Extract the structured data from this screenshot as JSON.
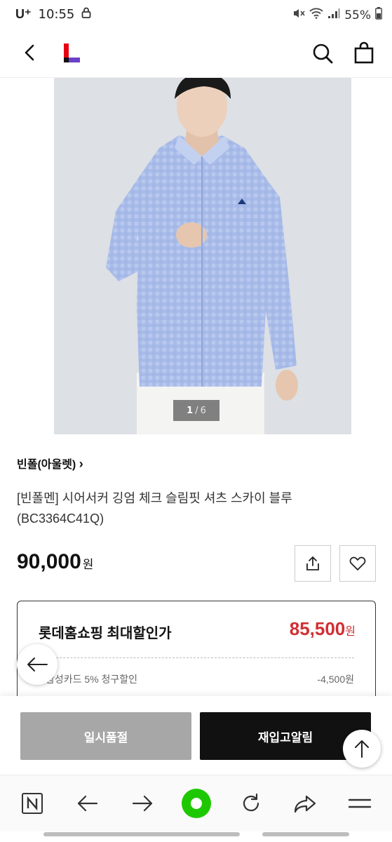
{
  "status_bar": {
    "carrier": "U⁺",
    "time": "10:55",
    "battery": "55%"
  },
  "header": {
    "logo_colors": [
      "#e60012",
      "#6a3fc9",
      "#111111"
    ]
  },
  "gallery": {
    "current": "1",
    "separator": "/",
    "total": "6"
  },
  "product": {
    "brand": "빈폴(아울렛)",
    "brand_chevron": "›",
    "title": "[빈폴멘] 시어서커 깅엄 체크 슬림핏 셔츠 스카이 블루 (BC3364C41Q)",
    "price": "90,000",
    "price_unit": "원"
  },
  "discount": {
    "label": "롯데홈쇼핑 최대할인가",
    "price": "85,500",
    "unit": "원",
    "card_label": "삼성카드 5% 청구할인",
    "card_amount": "-4,500원"
  },
  "actions": {
    "sold_out": "일시품절",
    "restock": "재입고알림"
  },
  "colors": {
    "accent_red": "#d12f33",
    "sold_out_gray": "#a7a7a7",
    "primary_black": "#111111",
    "browser_green": "#1ec800"
  }
}
